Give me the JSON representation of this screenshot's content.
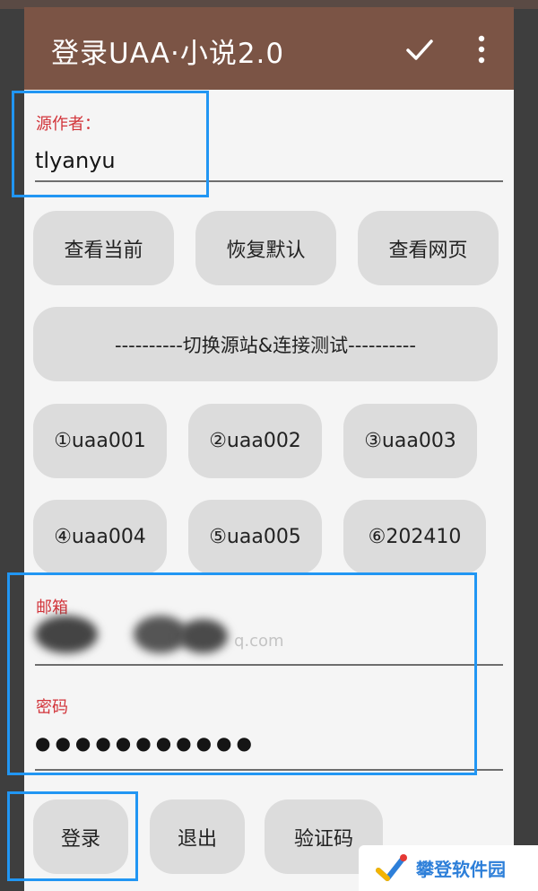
{
  "appbar": {
    "title": "登录UAA·小说2.0",
    "confirm_icon": "check-icon",
    "menu_icon": "more-vert-icon"
  },
  "source_author": {
    "label": "源作者：",
    "value": "tlyanyu"
  },
  "actions": {
    "view_current": "查看当前",
    "restore_default": "恢复默认",
    "view_webpage": "查看网页"
  },
  "switch_button": "----------切换源站&连接测试----------",
  "sites": [
    "①uaa001",
    "②uaa002",
    "③uaa003",
    "④uaa004",
    "⑤uaa005",
    "⑥202410"
  ],
  "email": {
    "label": "邮箱",
    "value_fragment": "q.com"
  },
  "password": {
    "label": "密码",
    "value": "●●●●●●●●●●●"
  },
  "bottom": {
    "login": "登录",
    "logout": "退出",
    "captcha": "验证码"
  },
  "watermark": {
    "text": "攀登软件园"
  },
  "colors": {
    "appbar": "#7b5445",
    "label_red": "#d2343a",
    "highlight": "#2196f3",
    "button": "#dcdcdc"
  }
}
